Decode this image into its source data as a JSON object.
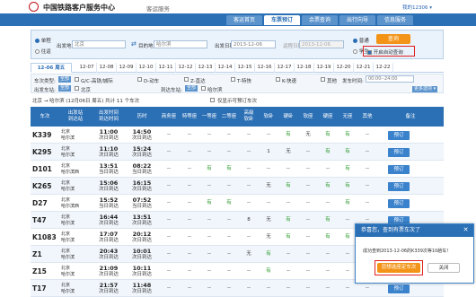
{
  "header": {
    "brand": "中国铁路客户服务中心",
    "section": "客运服务",
    "user": "我的12306 ▾"
  },
  "nav": {
    "tabs": [
      "客运首页",
      "车票预订",
      "余票查询",
      "出行向导",
      "信息服务"
    ],
    "active": 1
  },
  "search": {
    "trip_types": [
      "单程",
      "往返"
    ],
    "from_label": "出发地",
    "from_value": "北京",
    "to_label": "目的地",
    "to_value": "哈尔滨",
    "date_label": "出发日期",
    "date_value": "2013-12-06",
    "return_label": "返程日期",
    "return_value": "2013-12-06",
    "passenger_types": [
      "普通",
      "学生"
    ],
    "query_button": "查询",
    "auto_query_label": "开启自动查询"
  },
  "dates": [
    "12-06 周五",
    "12-07",
    "12-08",
    "12-09",
    "12-10",
    "12-11",
    "12-12",
    "12-13",
    "12-14",
    "12-15",
    "12-16",
    "12-17",
    "12-18",
    "12-19",
    "12-20",
    "12-21",
    "12-22"
  ],
  "filters": {
    "type_label": "车次类型:",
    "all_tag": "全部",
    "types": [
      "G/C-高铁/城际",
      "D-动车",
      "Z-直达",
      "T-特快",
      "K-快速",
      "其他"
    ],
    "depart_station_label": "出发车站:",
    "arrive_station_label": "到达车站:",
    "depart_stations": [
      "北京"
    ],
    "arrive_stations": [
      "哈尔滨"
    ],
    "time_label": "发车时间:",
    "time_value": "00:00--24:00",
    "more_label": "更多选项 ▾"
  },
  "info": {
    "route": "北京 → 哈尔滨 (12月06日 周五) 共计 11 个车次",
    "show_available": "仅显示可预订车次"
  },
  "columns": [
    "车次",
    "出发站\n到达站",
    "出发时间\n到达时间",
    "历时",
    "商务座",
    "特等座",
    "一等座",
    "二等座",
    "高级\n软卧",
    "软卧",
    "硬卧",
    "软座",
    "硬座",
    "无座",
    "其他",
    "备注"
  ],
  "rows": [
    {
      "train": "K339",
      "from": "北京",
      "to": "哈尔滨",
      "dep": "11:00",
      "arr": "次日到达",
      "dur": "14:50",
      "dur2": "次日到达",
      "seats": [
        "--",
        "--",
        "--",
        "--",
        "--",
        "--",
        "有",
        "无",
        "有",
        "有",
        "--"
      ]
    },
    {
      "train": "K295",
      "from": "北京",
      "to": "哈尔滨",
      "dep": "11:10",
      "arr": "次日到达",
      "dur": "15:24",
      "dur2": "次日到达",
      "seats": [
        "--",
        "--",
        "--",
        "--",
        "--",
        "1",
        "无",
        "--",
        "有",
        "有",
        "--"
      ]
    },
    {
      "train": "D101",
      "from": "北京",
      "to": "哈尔滨西",
      "dep": "13:51",
      "arr": "当日到达",
      "dur": "08:22",
      "dur2": "当日到达",
      "seats": [
        "--",
        "--",
        "有",
        "有",
        "--",
        "--",
        "--",
        "--",
        "--",
        "有",
        "--"
      ]
    },
    {
      "train": "K265",
      "from": "北京",
      "to": "哈尔滨",
      "dep": "15:06",
      "arr": "次日到达",
      "dur": "16:15",
      "dur2": "次日到达",
      "seats": [
        "--",
        "--",
        "--",
        "--",
        "--",
        "无",
        "有",
        "--",
        "有",
        "有",
        "--"
      ]
    },
    {
      "train": "D27",
      "from": "北京",
      "to": "哈尔滨西",
      "dep": "15:52",
      "arr": "当日到达",
      "dur": "07:52",
      "dur2": "当日到达",
      "seats": [
        "--",
        "--",
        "有",
        "有",
        "--",
        "--",
        "--",
        "--",
        "--",
        "有",
        "--"
      ]
    },
    {
      "train": "T47",
      "from": "北京",
      "to": "哈尔滨",
      "dep": "16:44",
      "arr": "次日到达",
      "dur": "13:51",
      "dur2": "次日到达",
      "seats": [
        "--",
        "--",
        "--",
        "--",
        "8",
        "无",
        "有",
        "--",
        "有",
        "--",
        "--"
      ]
    },
    {
      "train": "K1083",
      "from": "北京",
      "to": "哈尔滨",
      "dep": "17:07",
      "arr": "次日到达",
      "dur": "20:12",
      "dur2": "次日到达",
      "seats": [
        "--",
        "--",
        "--",
        "--",
        "--",
        "无",
        "有",
        "--",
        "有",
        "有",
        "--"
      ]
    },
    {
      "train": "Z1",
      "from": "北京",
      "to": "哈尔滨",
      "dep": "20:43",
      "arr": "次日到达",
      "dur": "10:01",
      "dur2": "次日到达",
      "seats": [
        "--",
        "--",
        "--",
        "--",
        "无",
        "有",
        "--",
        "--",
        "--",
        "--",
        "--"
      ]
    },
    {
      "train": "Z15",
      "from": "北京",
      "to": "哈尔滨",
      "dep": "21:09",
      "arr": "次日到达",
      "dur": "10:11",
      "dur2": "次日到达",
      "seats": [
        "--",
        "--",
        "--",
        "--",
        "--",
        "有",
        "--",
        "--",
        "--",
        "--",
        "--"
      ]
    },
    {
      "train": "T17",
      "from": "北京",
      "to": "哈尔滨",
      "dep": "21:57",
      "arr": "次日到达",
      "dur": "11:48",
      "dur2": "次日到达",
      "seats": [
        "--",
        "--",
        "--",
        "--",
        "--",
        "--",
        "--",
        "--",
        "--",
        "--",
        "--"
      ]
    }
  ],
  "book_label": "预订",
  "popup": {
    "title": "恭喜您，查到有票车次了",
    "message": "成功查到2013-12-06的K339次等10趟车！",
    "confirm": "您想选座定车次",
    "cancel": "关闭"
  }
}
